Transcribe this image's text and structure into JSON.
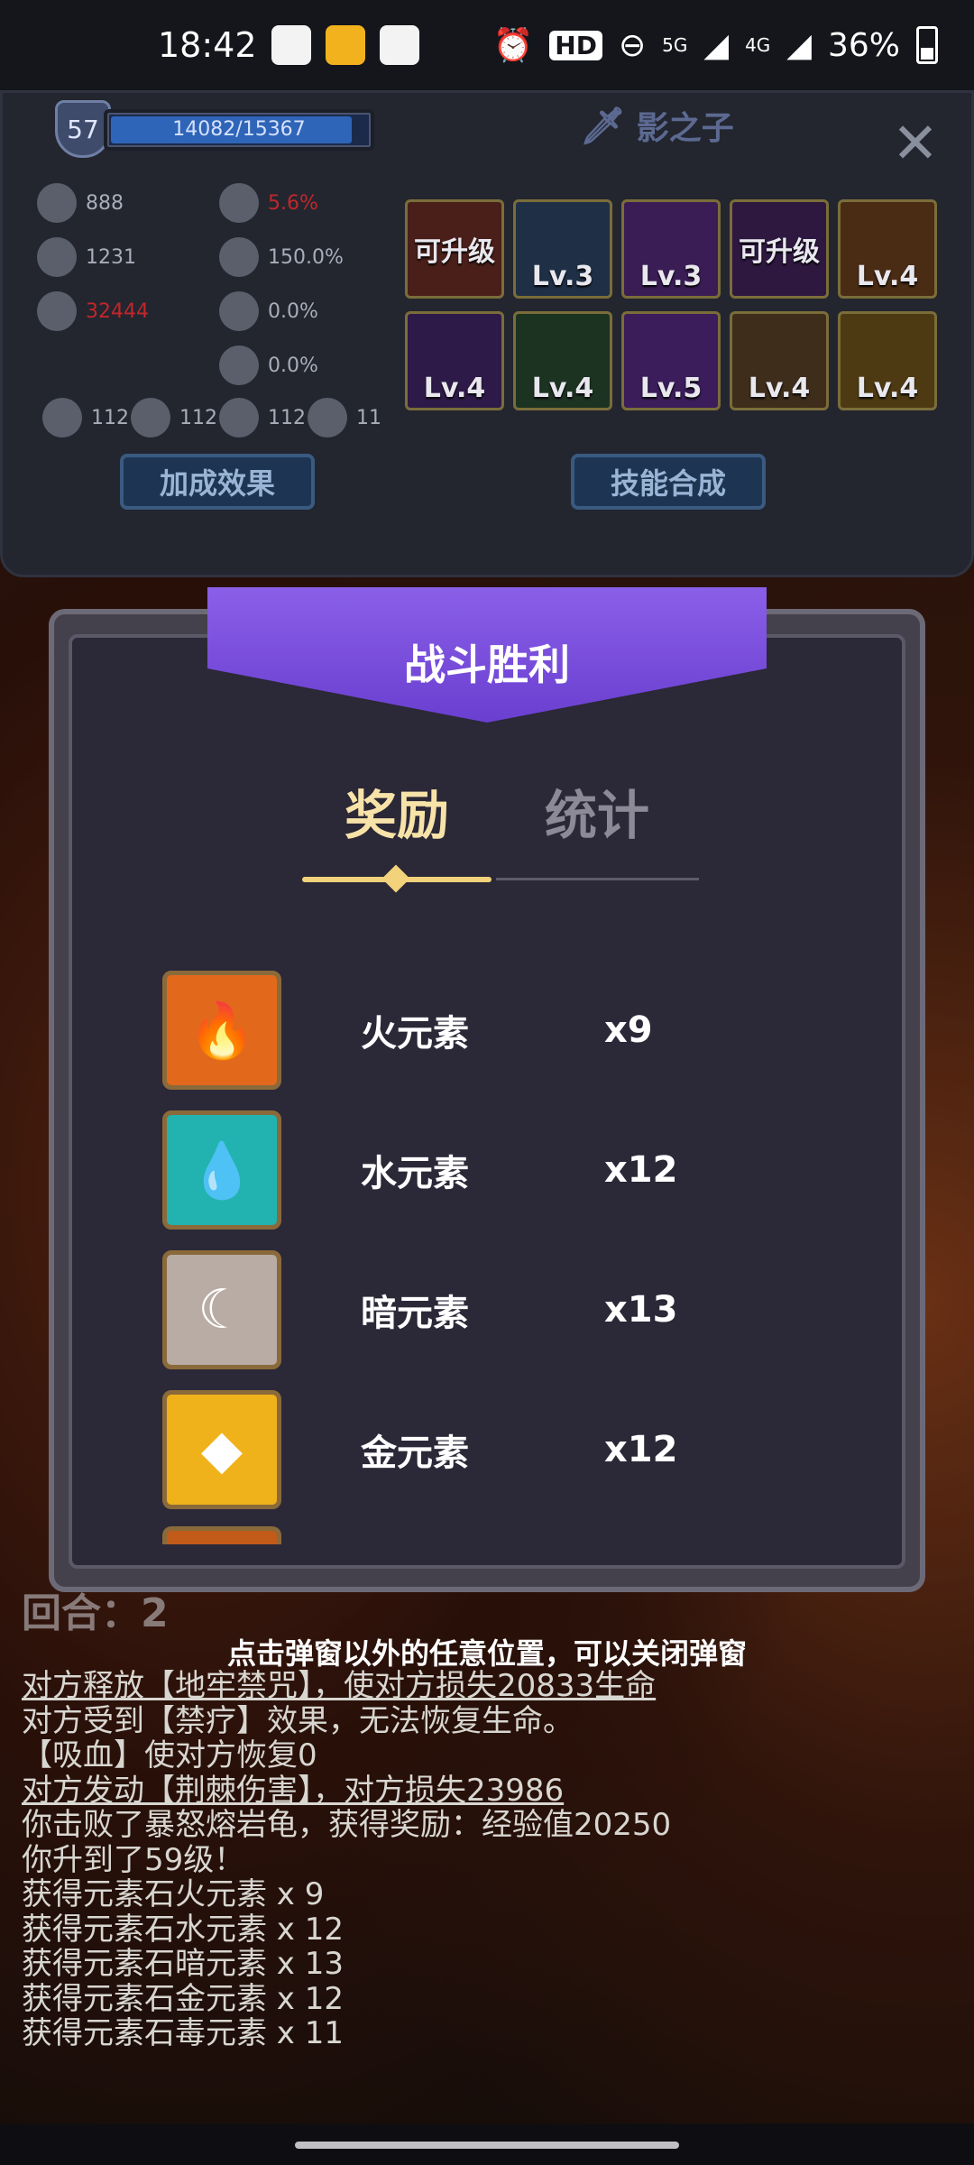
{
  "status_bar": {
    "time": "18:42",
    "hd_label": "HD",
    "signal_5g": "5G",
    "signal_4g": "4G",
    "battery": "36%"
  },
  "hero_panel": {
    "level": "57",
    "xp": "14082/15367",
    "xp_progress": 0.916,
    "hero_name": "影之子",
    "stats": {
      "attack": "888",
      "defense": "1231",
      "hp": "32444",
      "crit": "5.6%",
      "lifesteal": "150.0%",
      "stat_a": "0.0%",
      "stat_b": "0.0%",
      "fire": "112",
      "ice": "112",
      "lightning": "112",
      "poison": "11"
    },
    "skills": [
      {
        "label": "可升级"
      },
      {
        "label": "Lv.3"
      },
      {
        "label": "Lv.3"
      },
      {
        "label": "可升级"
      },
      {
        "label": "Lv.4"
      },
      {
        "label": "Lv.4"
      },
      {
        "label": "Lv.4"
      },
      {
        "label": "Lv.5"
      },
      {
        "label": "Lv.4"
      },
      {
        "label": "Lv.4"
      }
    ],
    "bonus_button": "加成效果",
    "skill_merge_button": "技能合成"
  },
  "modal": {
    "title": "战斗胜利",
    "tabs": {
      "reward": "奖励",
      "stats": "统计"
    },
    "rewards": [
      {
        "name": "火元素",
        "count": "x9",
        "icon": "fire-element-icon",
        "color": "#e2691c"
      },
      {
        "name": "水元素",
        "count": "x12",
        "icon": "water-element-icon",
        "color": "#22b3b0"
      },
      {
        "name": "暗元素",
        "count": "x13",
        "icon": "dark-element-icon",
        "color": "#b8aca4"
      },
      {
        "name": "金元素",
        "count": "x12",
        "icon": "gold-element-icon",
        "color": "#f0b21a"
      }
    ],
    "hint": "点击弹窗以外的任意位置，可以关闭弹窗"
  },
  "log": {
    "round_label": "回合：2",
    "lines": [
      "对方释放【地牢禁咒】，使对方损失20833生命",
      "对方受到【禁疗】效果，无法恢复生命。",
      "【吸血】使对方恢复0",
      "对方发动【荆棘伤害】，对方损失23986",
      "你击败了暴怒熔岩龟，获得奖励：经验值20250",
      "你升到了59级！",
      "获得元素石火元素 x 9",
      "获得元素石水元素 x 12",
      "获得元素石暗元素 x 13",
      "获得元素石金元素 x 12",
      "获得元素石毒元素 x 11"
    ]
  }
}
